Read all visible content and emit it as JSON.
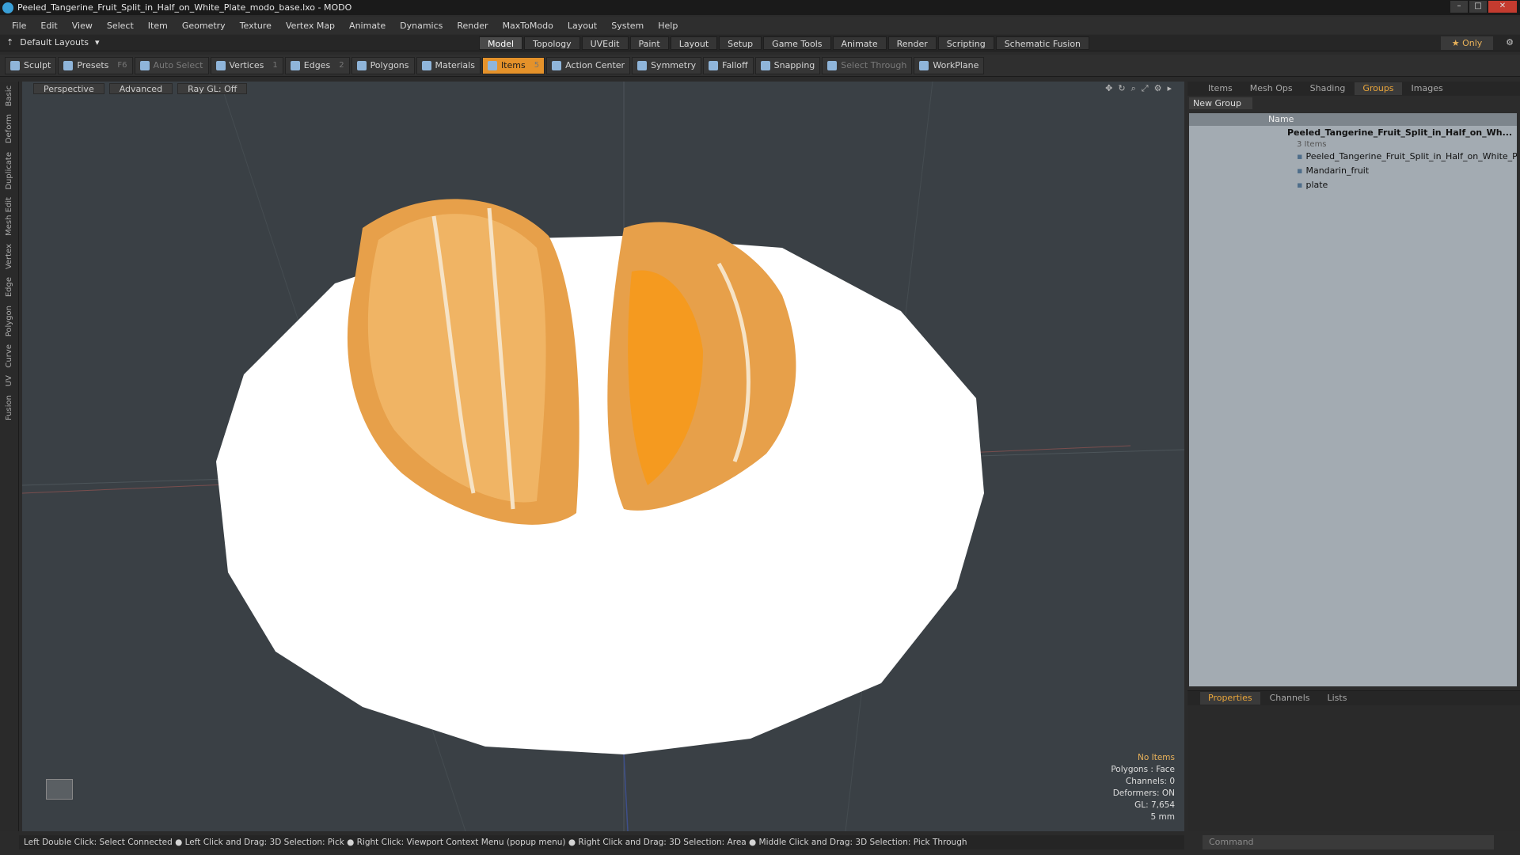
{
  "window": {
    "title": "Peeled_Tangerine_Fruit_Split_in_Half_on_White_Plate_modo_base.lxo - MODO"
  },
  "menu": [
    "File",
    "Edit",
    "View",
    "Select",
    "Item",
    "Geometry",
    "Texture",
    "Vertex Map",
    "Animate",
    "Dynamics",
    "Render",
    "MaxToModo",
    "Layout",
    "System",
    "Help"
  ],
  "layout": {
    "default_layouts": "Default Layouts",
    "only": "Only"
  },
  "tabs": [
    "Model",
    "Topology",
    "UVEdit",
    "Paint",
    "Layout",
    "Setup",
    "Game Tools",
    "Animate",
    "Render",
    "Scripting",
    "Schematic Fusion"
  ],
  "toolbar": [
    {
      "label": "Sculpt"
    },
    {
      "label": "Presets",
      "key": "F6"
    },
    {
      "label": "Auto Select",
      "dim": true
    },
    {
      "label": "Vertices",
      "key": "1"
    },
    {
      "label": "Edges",
      "key": "2"
    },
    {
      "label": "Polygons"
    },
    {
      "label": "Materials"
    },
    {
      "label": "Items",
      "key": "5",
      "active": true
    },
    {
      "label": "Action Center"
    },
    {
      "label": "Symmetry"
    },
    {
      "label": "Falloff"
    },
    {
      "label": "Snapping"
    },
    {
      "label": "Select Through",
      "dim": true
    },
    {
      "label": "WorkPlane"
    }
  ],
  "sidebar": [
    "Basic",
    "Deform",
    "Duplicate",
    "Mesh Edit",
    "Vertex",
    "Edge",
    "Polygon",
    "Curve",
    "UV",
    "Fusion"
  ],
  "viewport": {
    "view": "Perspective",
    "mode": "Advanced",
    "raygl": "Ray GL: Off"
  },
  "stats": {
    "no_items": "No Items",
    "lines": [
      "Polygons : Face",
      "Channels: 0",
      "Deformers: ON",
      "GL: 7,654",
      "5 mm"
    ]
  },
  "right_tabs": [
    "Items",
    "Mesh Ops",
    "Shading",
    "Groups",
    "Images"
  ],
  "right_active": "Groups",
  "groups": {
    "new_group": "New Group",
    "name_header": "Name",
    "root": "Peeled_Tangerine_Fruit_Split_in_Half_on_Wh...",
    "count": "3 Items",
    "children": [
      "Peeled_Tangerine_Fruit_Split_in_Half_on_White_Plate",
      "Mandarin_fruit",
      "plate"
    ]
  },
  "bottom_tabs": [
    "Properties",
    "Channels",
    "Lists"
  ],
  "command_placeholder": "Command",
  "status": "Left Double Click: Select Connected ● Left Click and Drag: 3D Selection: Pick ● Right Click: Viewport Context Menu (popup menu) ● Right Click and Drag: 3D Selection: Area ● Middle Click and Drag: 3D Selection: Pick Through"
}
